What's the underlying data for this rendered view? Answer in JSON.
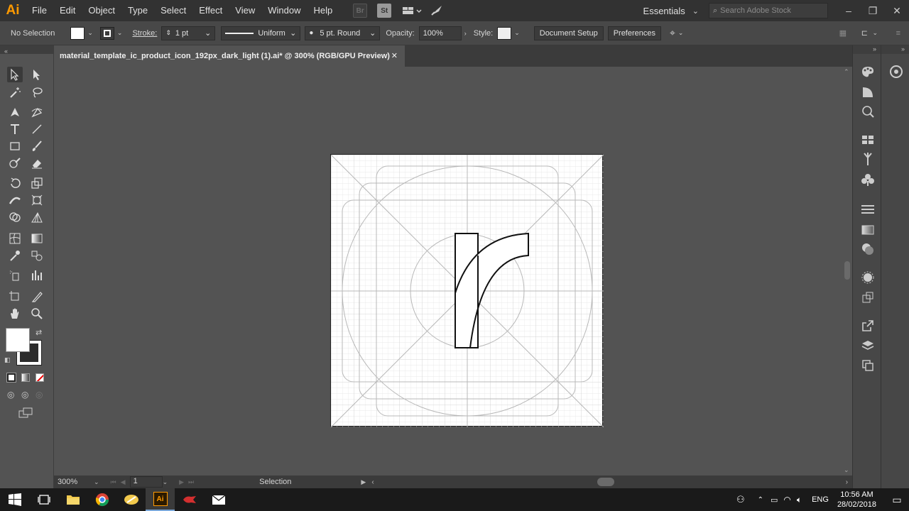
{
  "app": {
    "logo": "Ai"
  },
  "menu": [
    "File",
    "Edit",
    "Object",
    "Type",
    "Select",
    "Effect",
    "View",
    "Window",
    "Help"
  ],
  "app_switcher": {
    "br": "Br",
    "st": "St"
  },
  "workspace": {
    "label": "Essentials"
  },
  "search": {
    "placeholder": "Search Adobe Stock"
  },
  "control_bar": {
    "selection_label": "No Selection",
    "stroke_label": "Stroke:",
    "stroke_weight": "1 pt",
    "profile": "Uniform",
    "brush": "5 pt. Round",
    "opacity_label": "Opacity:",
    "opacity_value": "100%",
    "style_label": "Style:",
    "document_setup": "Document Setup",
    "preferences": "Preferences"
  },
  "document": {
    "tab_title": "material_template_ic_product_icon_192px_dark_light (1).ai* @ 300% (RGB/GPU Preview)",
    "close": "✕"
  },
  "status": {
    "zoom": "300%",
    "artboard": "1",
    "tool": "Selection"
  },
  "taskbar": {
    "time": "10:56 AM",
    "date": "28/02/2018",
    "lang": "ENG"
  },
  "colors": {
    "accent": "#ff9a00",
    "canvas": "#535353",
    "chrome": "#323232"
  }
}
